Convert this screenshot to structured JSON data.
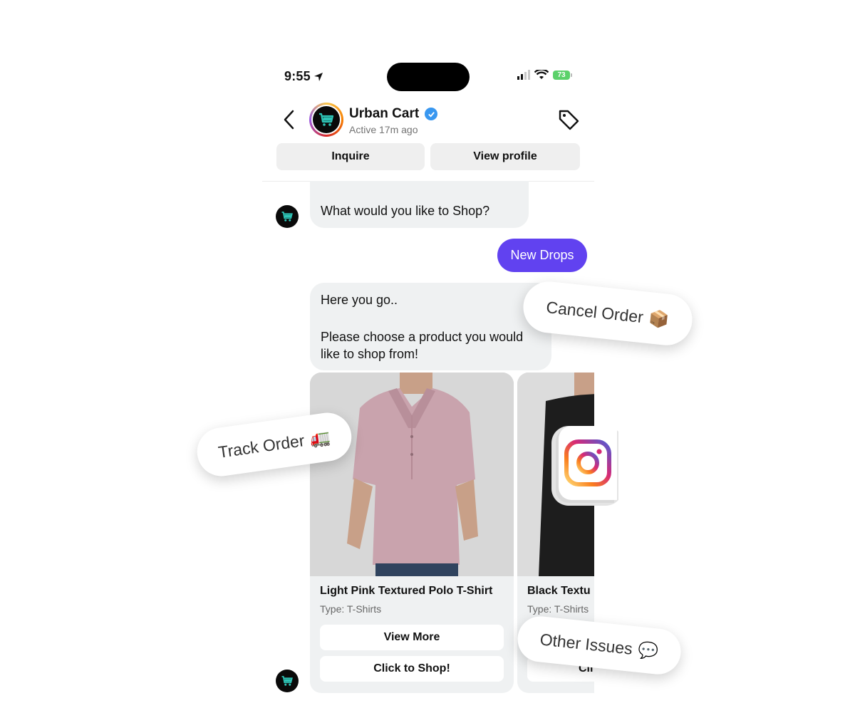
{
  "status_bar": {
    "time": "9:55",
    "battery": "73"
  },
  "header": {
    "title": "Urban Cart",
    "subtitle": "Active 17m ago",
    "inquire_label": "Inquire",
    "view_profile_label": "View profile"
  },
  "messages": {
    "shop_question": "What would you like to Shop?",
    "user_reply": "New Drops",
    "bot_reply_line1": "Here you go..",
    "bot_reply_line2": "Please choose a product you would like to shop from!"
  },
  "products": [
    {
      "title": "Light Pink Textured Polo T-Shirt",
      "type": "Type: T-Shirts",
      "view_more": "View More",
      "shop": "Click to Shop!"
    },
    {
      "title": "Black Textu",
      "type": "Type: T-Shirts",
      "view_more": "",
      "shop": "Cli"
    }
  ],
  "overlays": {
    "cancel_order": "Cancel Order",
    "cancel_order_emoji": "📦",
    "track_order": "Track Order",
    "track_order_emoji": "🚛",
    "other_issues": "Other Issues",
    "other_issues_emoji": "💬"
  },
  "colors": {
    "accent": "#6142f0",
    "bubble": "#eff1f2",
    "verified": "#3897f0",
    "logo_cart": "#2ec4b6"
  }
}
